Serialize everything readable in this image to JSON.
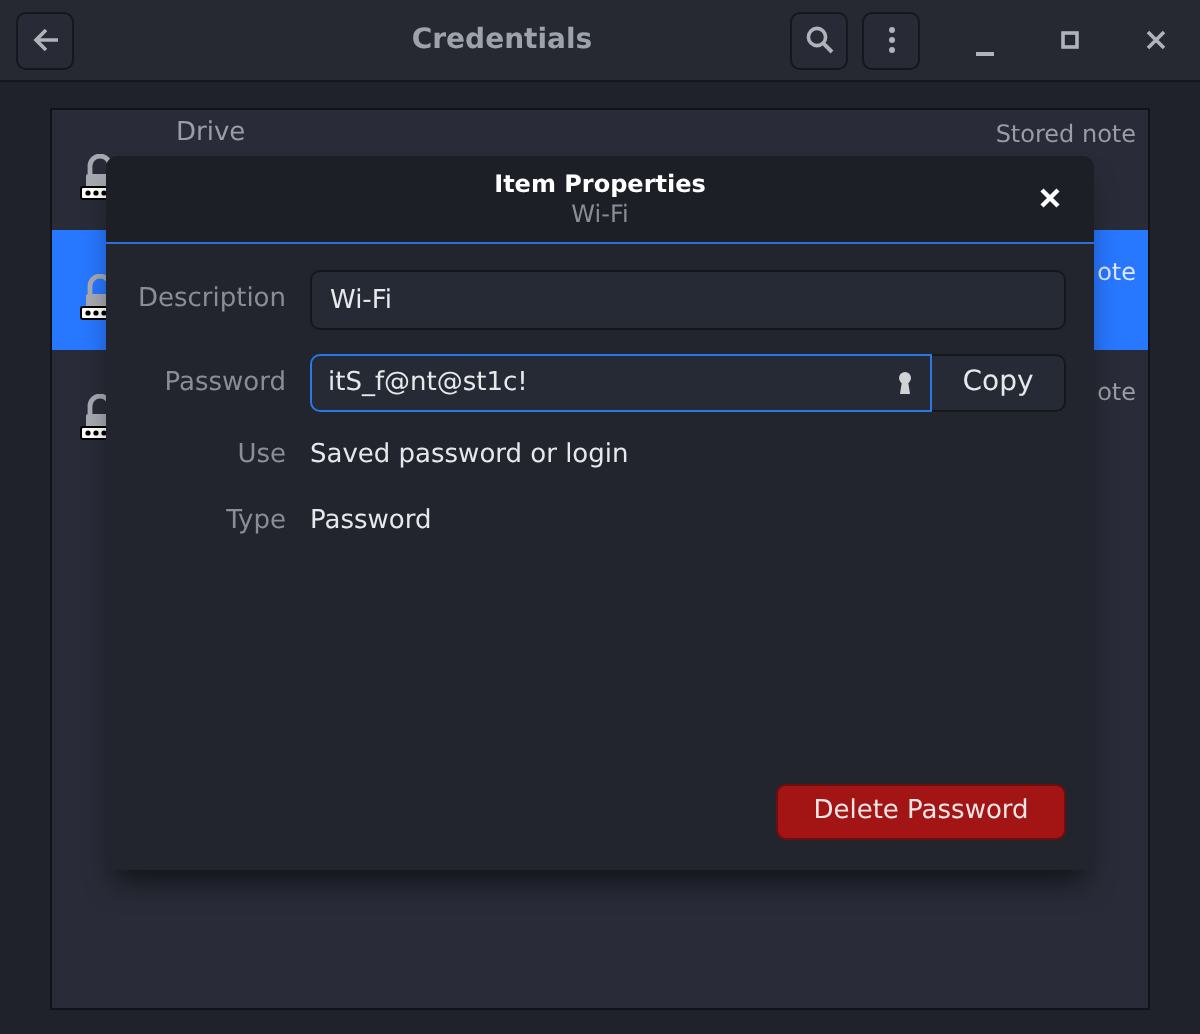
{
  "window": {
    "title": "Credentials"
  },
  "items": [
    {
      "title": "Drive",
      "type_label": "Stored note",
      "selected": false
    },
    {
      "type_label": "ote",
      "selected": true
    },
    {
      "type_label": "ote",
      "selected": false
    }
  ],
  "dialog": {
    "title": "Item Properties",
    "subtitle": "Wi-Fi",
    "fields": [
      {
        "label": "Description",
        "kind": "entry",
        "value": "Wi-Fi",
        "focused": false
      },
      {
        "label": "Password",
        "kind": "secret",
        "value": "itS_f@nt@st1c!",
        "focused": true,
        "button": "Copy"
      },
      {
        "label": "Use",
        "kind": "text",
        "value": "Saved password or login"
      },
      {
        "label": "Type",
        "kind": "text",
        "value": "Password"
      }
    ],
    "delete_button": "Delete Password"
  }
}
